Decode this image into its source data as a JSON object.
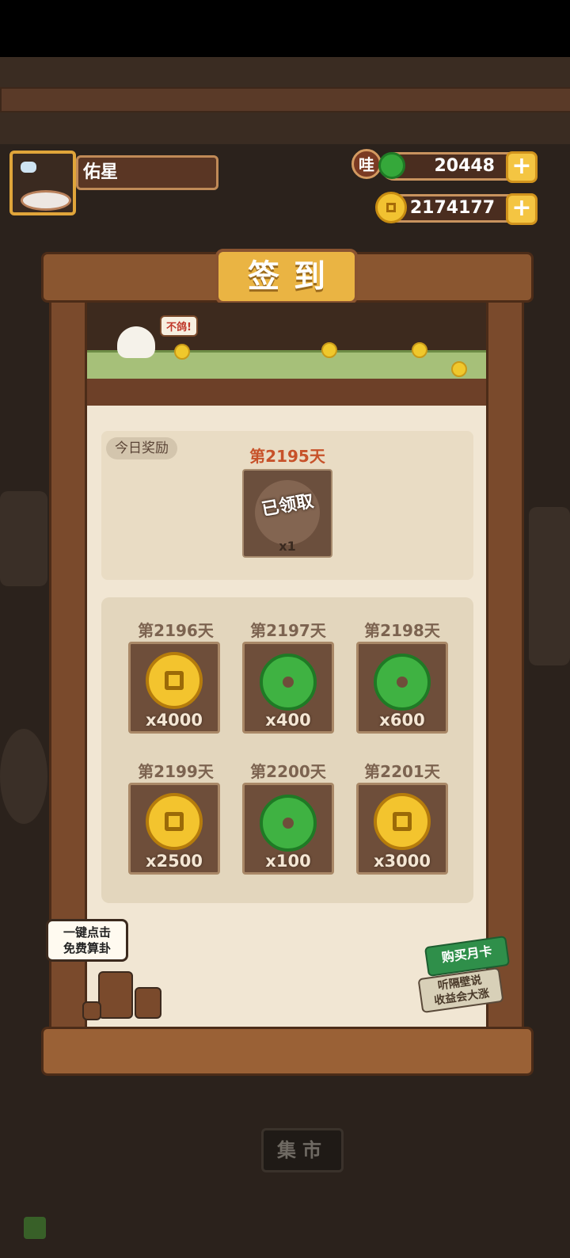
{
  "header": {
    "player_name": "佑星",
    "jade_badge": "哇",
    "jade_amount": "20448",
    "coin_amount": "2174177",
    "plus_symbol": "+"
  },
  "panel": {
    "title": "签到",
    "speech": "不鸽!"
  },
  "today": {
    "tag": "今日奖励",
    "day": "第2195天",
    "status": "已领取",
    "quantity": "x1"
  },
  "rewards": [
    {
      "day": "第2196天",
      "type": "coin",
      "qty": "x4000"
    },
    {
      "day": "第2197天",
      "type": "jade",
      "qty": "x400"
    },
    {
      "day": "第2198天",
      "type": "jade",
      "qty": "x600"
    },
    {
      "day": "第2199天",
      "type": "coin",
      "qty": "x2500"
    },
    {
      "day": "第2200天",
      "type": "jade",
      "qty": "x100"
    },
    {
      "day": "第2201天",
      "type": "coin",
      "qty": "x3000"
    }
  ],
  "left_bubble": {
    "line1": "一键点击",
    "line2": "免费算卦"
  },
  "month_card": {
    "title": "购买月卡",
    "line1": "听隔壁说",
    "line2": "收益会大涨"
  },
  "bottom_button": "集市",
  "colors": {
    "accent": "#eab443",
    "jade": "#3fb242",
    "coin": "#f3c42e",
    "day_highlight": "#c7522a"
  }
}
